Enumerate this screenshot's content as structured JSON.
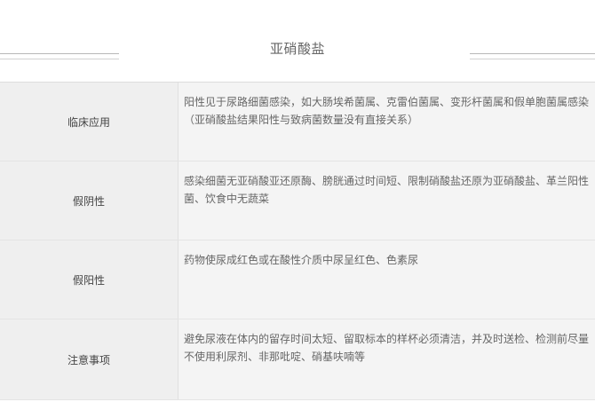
{
  "title": "亚硝酸盐",
  "rows": [
    {
      "label": "临床应用",
      "text": "阳性见于尿路细菌感染，如大肠埃希菌属、克雷伯菌属、变形杆菌属和假单胞菌属感染（亚硝酸盐结果阳性与致病菌数量没有直接关系）"
    },
    {
      "label": "假阴性",
      "text": "感染细菌无亚硝酸亚还原酶、膀胱通过时间短、限制硝酸盐还原为亚硝酸盐、革兰阳性菌、饮食中无蔬菜"
    },
    {
      "label": "假阳性",
      "text": "药物使尿成红色或在酸性介质中尿呈红色、色素尿"
    },
    {
      "label": "注意事项",
      "text": "避免尿液在体内的留存时间太短、留取标本的样杯必须清洁，并及时送检、检测前尽量不使用利尿剂、非那吡啶、硝基呋喃等"
    }
  ]
}
